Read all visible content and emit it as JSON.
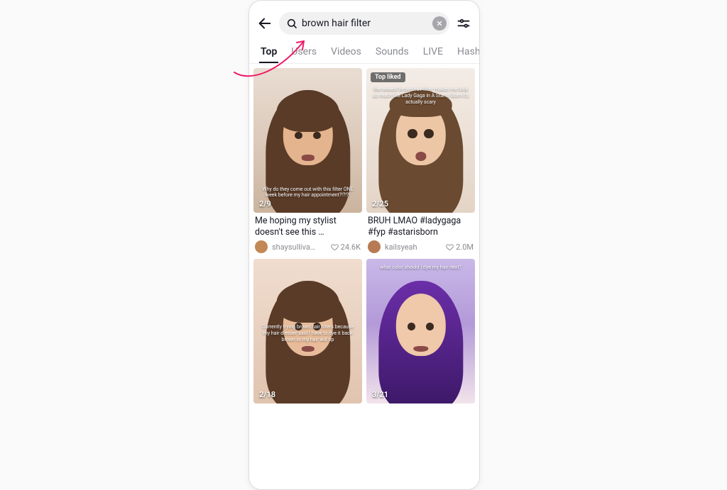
{
  "colors": {
    "annotate": "#f01b66",
    "hair_brown": "#5a3b28",
    "hair_brown_light": "#7a5539",
    "skin_warm": "#e5b795",
    "skin_cool": "#f0cfb8",
    "hair_purple": "#6b2ea8",
    "hair_purple_dark": "#3b1866"
  },
  "search": {
    "value": "brown hair filter",
    "placeholder": "Search"
  },
  "tabs": [
    "Top",
    "Users",
    "Videos",
    "Sounds",
    "LIVE",
    "Hashtags"
  ],
  "active_tab": 0,
  "results": [
    {
      "badge": "",
      "overlay": "Why do they come out with this filter ONE week before my hair appointment?!?!?!",
      "overlay_pos": "bottom",
      "date": "2/9",
      "caption": "Me hoping my stylist doesn't see this …",
      "username": "shaysulliva…",
      "likes": "24.6K",
      "avatar_bg": "#c28855",
      "thumb_bg": "linear-gradient(180deg,#e9ddd2 0%, #d9c6b5 60%, #cbb49e 100%)",
      "hair_color": "#5a3b28",
      "skin": "#e4b48e"
    },
    {
      "badge": "Top liked",
      "overlay": "the newest brown hair filter makes me look so much like Lady Gaga in A Star is Born it's actually scary",
      "overlay_pos": "top",
      "date": "2/25",
      "caption": "BRUH LMAO #ladygaga #fyp #astarisborn",
      "username": "kailsyeah",
      "likes": "2.0M",
      "avatar_bg": "#b77a53",
      "thumb_bg": "linear-gradient(180deg,#f3ece6 0%, #e4d4c6 100%)",
      "hair_color": "#6a4a30",
      "skin": "#edc6a5"
    },
    {
      "badge": "",
      "overlay": "Currently trying brown hair filters because my hair dresser said I have to dye it back brown or my hair will rip",
      "overlay_pos": "mid",
      "date": "2/18",
      "caption": "",
      "username": "",
      "likes": "",
      "avatar_bg": "",
      "thumb_bg": "linear-gradient(180deg,#f0ddcf 0%, #e0c4af 100%)",
      "hair_color": "#5a3b28",
      "skin": "#e8bc9a"
    },
    {
      "badge": "",
      "overlay": "what color should I dye my hair next?",
      "overlay_pos": "top",
      "date": "3/21",
      "caption": "",
      "username": "",
      "likes": "",
      "avatar_bg": "",
      "thumb_bg": "linear-gradient(180deg,#c9b8e8 0%, #b39ad8 45%, #f2e3ea 100%)",
      "hair_color": "linear-gradient(180deg,#6b2ea8 0%, #3b1866 100%)",
      "skin": "#f0c8aa"
    }
  ]
}
